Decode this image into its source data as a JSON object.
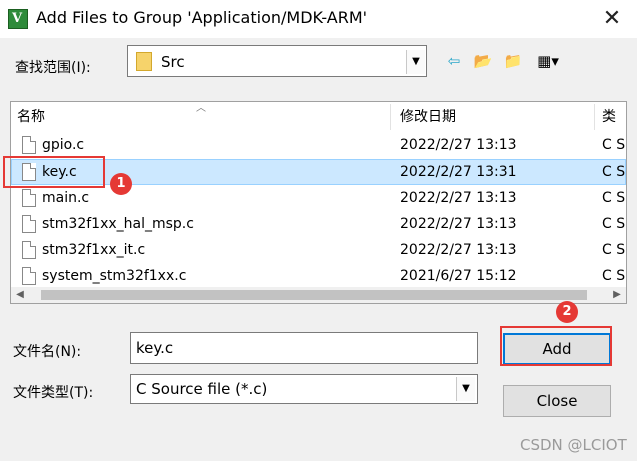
{
  "window": {
    "title": "Add Files to Group 'Application/MDK-ARM'",
    "app_icon_glyph": "V",
    "close_glyph": "✕"
  },
  "lookin": {
    "label": "查找范围(I):",
    "value": "Src"
  },
  "toolbar": {
    "back_glyph": "⇦",
    "up_glyph": "📂",
    "new_glyph": "📁",
    "view_glyph": "▦▾"
  },
  "columns": {
    "name": "名称",
    "date": "修改日期",
    "type": "类"
  },
  "files": [
    {
      "name": "gpio.c",
      "date": "2022/2/27 13:13",
      "type": "C S"
    },
    {
      "name": "key.c",
      "date": "2022/2/27 13:31",
      "type": "C S"
    },
    {
      "name": "main.c",
      "date": "2022/2/27 13:13",
      "type": "C S"
    },
    {
      "name": "stm32f1xx_hal_msp.c",
      "date": "2022/2/27 13:13",
      "type": "C S"
    },
    {
      "name": "stm32f1xx_it.c",
      "date": "2022/2/27 13:13",
      "type": "C S"
    },
    {
      "name": "system_stm32f1xx.c",
      "date": "2021/6/27 15:12",
      "type": "C S"
    }
  ],
  "filename": {
    "label": "文件名(N):",
    "value": "key.c"
  },
  "filetype": {
    "label": "文件类型(T):",
    "value": "C Source file (*.c)"
  },
  "buttons": {
    "add": "Add",
    "close": "Close"
  },
  "annotations": {
    "badge1": "1",
    "badge2": "2",
    "color": "#e53935"
  },
  "watermark": "CSDN @LCIOT"
}
